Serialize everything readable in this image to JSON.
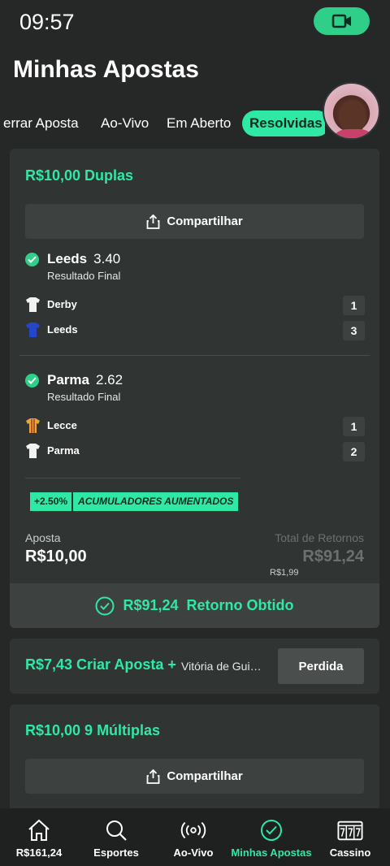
{
  "status_bar": {
    "time": "09:57"
  },
  "page": {
    "title": "Minhas Apostas"
  },
  "tabs": [
    {
      "label": "errar Aposta"
    },
    {
      "label": "Ao-Vivo"
    },
    {
      "label": "Em Aberto"
    },
    {
      "label": "Resolvidas",
      "active": true
    }
  ],
  "bet1": {
    "title": "R$10,00 Duplas",
    "share_label": "Compartilhar",
    "selections": [
      {
        "name": "Leeds",
        "odds": "3.40",
        "market": "Resultado Final",
        "teams": [
          {
            "name": "Derby",
            "score": "1"
          },
          {
            "name": "Leeds",
            "score": "3"
          }
        ]
      },
      {
        "name": "Parma",
        "odds": "2.62",
        "market": "Resultado Final",
        "teams": [
          {
            "name": "Lecce",
            "score": "1"
          },
          {
            "name": "Parma",
            "score": "2"
          }
        ]
      }
    ],
    "boost_pct": "+2.50%",
    "boost_label": "ACUMULADORES AUMENTADOS",
    "stake_label": "Aposta",
    "stake_value": "R$10,00",
    "returns_label": "Total de Retornos",
    "returns_value": "R$91,24",
    "returns_sub": "R$1,99",
    "result_amount": "R$91,24",
    "result_label": "Retorno Obtido"
  },
  "bet2": {
    "title": "R$7,43 Criar Aposta +",
    "description": "Vitória de Guimarães",
    "status": "Perdida"
  },
  "bet3": {
    "title": "R$10,00 9 Múltiplas",
    "share_label": "Compartilhar"
  },
  "bottom_nav": [
    {
      "label": "R$161,24",
      "icon": "home-icon"
    },
    {
      "label": "Esportes",
      "icon": "search-icon"
    },
    {
      "label": "Ao-Vivo",
      "icon": "live-icon"
    },
    {
      "label": "Minhas Apostas",
      "icon": "check-circle-icon",
      "active": true
    },
    {
      "label": "Cassino",
      "icon": "slot-machine-icon"
    }
  ],
  "colors": {
    "accent": "#2fe8a5",
    "background": "#262827",
    "card": "#303533"
  }
}
